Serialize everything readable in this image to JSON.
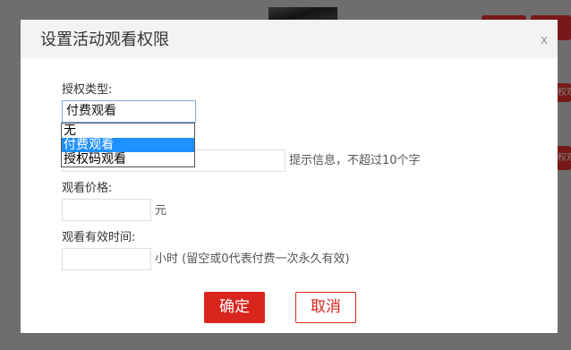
{
  "background": {
    "row_action_labels": [
      "权观",
      "权观"
    ]
  },
  "dialog": {
    "title": "设置活动观看权限",
    "close_label": "x",
    "auth_type": {
      "label": "授权类型:",
      "selected": "付费观看",
      "options": [
        "无",
        "付费观看",
        "授权码观看"
      ],
      "highlighted_index": 1
    },
    "tip": {
      "value": "",
      "hint": "提示信息，不超过10个字"
    },
    "price": {
      "label": "观看价格:",
      "value": "",
      "unit": "元"
    },
    "valid_time": {
      "label": "观看有效时间:",
      "value": "",
      "unit": "小时 (留空或0代表付费一次永久有效)"
    },
    "confirm_label": "确定",
    "cancel_label": "取消"
  },
  "colors": {
    "accent": "#d9251d",
    "option_highlight": "#1e90ff",
    "select_focus_border": "#7eaee0",
    "header_bg": "#f3f3f3"
  }
}
